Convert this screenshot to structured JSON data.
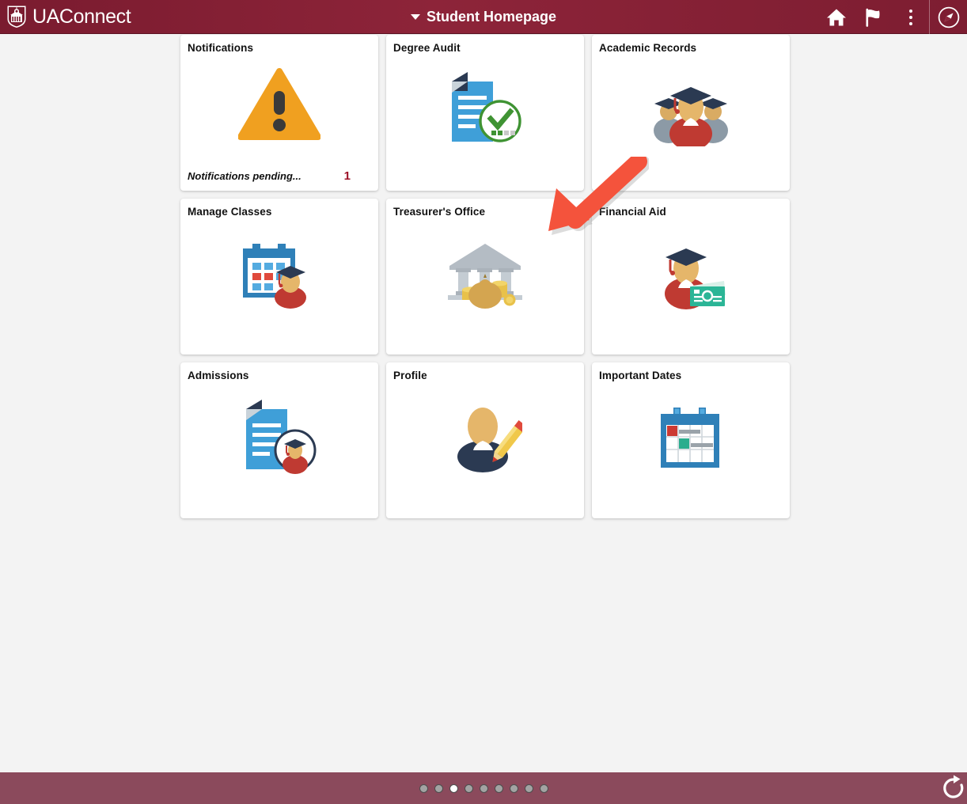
{
  "header": {
    "brand_name": "UAConnect",
    "brand_logo_icon": "shield-building-logo",
    "homepage_title": "Student Homepage",
    "caret_icon": "chevron-down-icon",
    "actions": [
      {
        "name": "home-icon",
        "label": "Home"
      },
      {
        "name": "flag-icon",
        "label": "Notifications"
      },
      {
        "name": "kebab-menu-icon",
        "label": "Actions"
      },
      {
        "name": "compass-icon",
        "label": "NavBar"
      }
    ]
  },
  "tiles": [
    {
      "title": "Notifications",
      "icon": "warning-triangle-icon",
      "footer_message": "Notifications pending...",
      "count": "1"
    },
    {
      "title": "Degree Audit",
      "icon": "document-check-icon"
    },
    {
      "title": "Academic Records",
      "icon": "graduates-group-icon"
    },
    {
      "title": "Manage Classes",
      "icon": "calendar-graduate-icon"
    },
    {
      "title": "Treasurer's Office",
      "icon": "bank-money-icon"
    },
    {
      "title": "Financial Aid",
      "icon": "graduate-money-icon"
    },
    {
      "title": "Admissions",
      "icon": "document-graduate-icon"
    },
    {
      "title": "Profile",
      "icon": "person-pencil-icon"
    },
    {
      "title": "Important Dates",
      "icon": "calendar-events-icon"
    }
  ],
  "annotation": {
    "type": "arrow",
    "color": "#f4533c",
    "points_to": "Treasurer's Office"
  },
  "bottom_bar": {
    "page_count": 9,
    "active_page": 3,
    "refresh_icon": "refresh-icon"
  },
  "colors": {
    "header_maroon": "#8d2439",
    "bottom_bar": "#8b4a5c",
    "page_background": "#f3f3f3",
    "count_red": "#9c1127",
    "arrow_red": "#f4533c"
  }
}
